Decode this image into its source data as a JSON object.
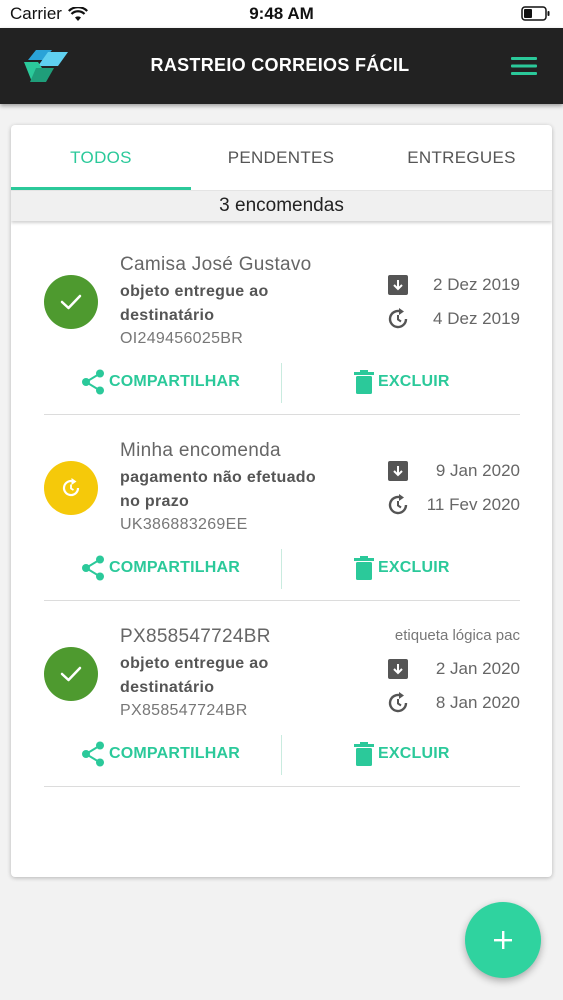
{
  "status_bar": {
    "carrier": "Carrier",
    "time": "9:48 AM"
  },
  "app_bar": {
    "title": "RASTREIO CORREIOS FÁCIL"
  },
  "tabs": [
    {
      "label": "TODOS",
      "active": true
    },
    {
      "label": "PENDENTES",
      "active": false
    },
    {
      "label": "ENTREGUES",
      "active": false
    }
  ],
  "count_label": "3 encomendas",
  "shipments": [
    {
      "name": "Camisa José Gustavo",
      "status_text": "objeto entregue ao destinatário",
      "code": "OI249456025BR",
      "tag": "",
      "state": "delivered",
      "posted_date": "2 Dez 2019",
      "updated_date": "4 Dez 2019"
    },
    {
      "name": "Minha encomenda",
      "status_text": "pagamento não efetuado no prazo",
      "code": "UK386883269EE",
      "tag": "",
      "state": "pending",
      "posted_date": "9 Jan 2020",
      "updated_date": "11 Fev 2020"
    },
    {
      "name": "PX858547724BR",
      "status_text": "objeto entregue ao destinatário",
      "code": "PX858547724BR",
      "tag": "etiqueta lógica pac",
      "state": "delivered",
      "posted_date": "2 Jan 2020",
      "updated_date": "8 Jan 2020"
    }
  ],
  "actions": {
    "share_label": "COMPARTILHAR",
    "delete_label": "EXCLUIR"
  },
  "fab": {
    "icon": "plus-icon"
  },
  "colors": {
    "accent": "#2bc99a",
    "appbar": "#222222",
    "delivered": "#4e9a2f",
    "pending": "#f5c90a"
  }
}
